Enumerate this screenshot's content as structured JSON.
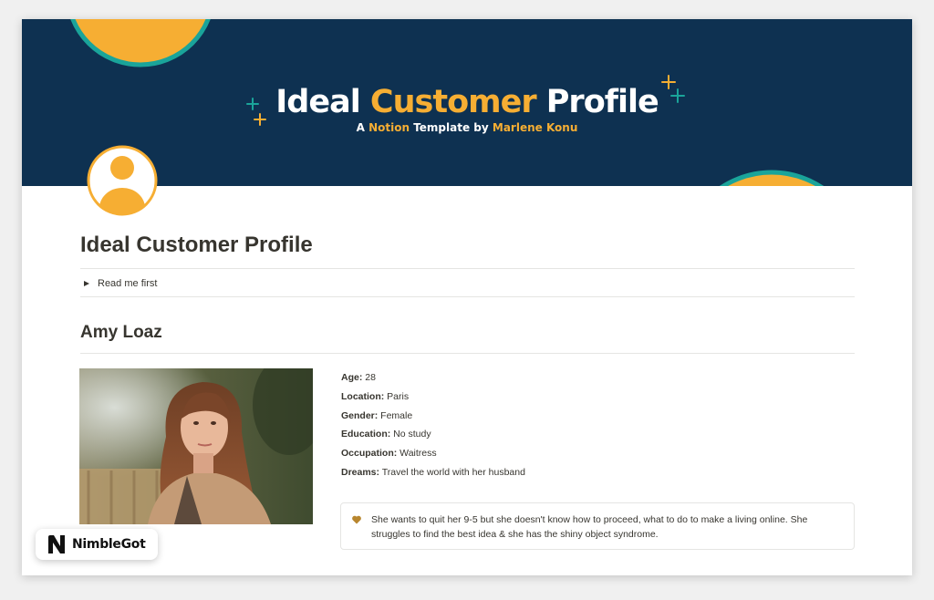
{
  "banner": {
    "title_part1": "Ideal ",
    "title_accent": "Customer",
    "title_part2": " Profile",
    "subtitle_part1": "A ",
    "subtitle_accent1": "Notion",
    "subtitle_part2": " Template by ",
    "subtitle_accent2": "Marlene Konu"
  },
  "page": {
    "title": "Ideal Customer Profile",
    "toggle_label": "Read me first",
    "section_heading": "Amy Loaz"
  },
  "profile": {
    "facts": [
      {
        "label": "Age:",
        "value": " 28"
      },
      {
        "label": "Location:",
        "value": " Paris"
      },
      {
        "label": "Gender:",
        "value": " Female"
      },
      {
        "label": "Education:",
        "value": " No study"
      },
      {
        "label": "Occupation:",
        "value": " Waitress"
      },
      {
        "label": "Dreams:",
        "value": " Travel the world with her husband"
      }
    ],
    "callout_text": "She wants to quit her 9-5 but she doesn't know how to proceed, what to do to make a living online. She struggles to find the best idea & she has the shiny object syndrome.",
    "callout_icon": "heart-icon"
  },
  "watermark": {
    "brand_name": "NimbleGot",
    "logo_icon": "n-logo-icon"
  },
  "colors": {
    "banner_bg": "#0e3151",
    "accent_yellow": "#f6ae33",
    "accent_teal": "#1aa49a",
    "heart": "#b8862e"
  }
}
